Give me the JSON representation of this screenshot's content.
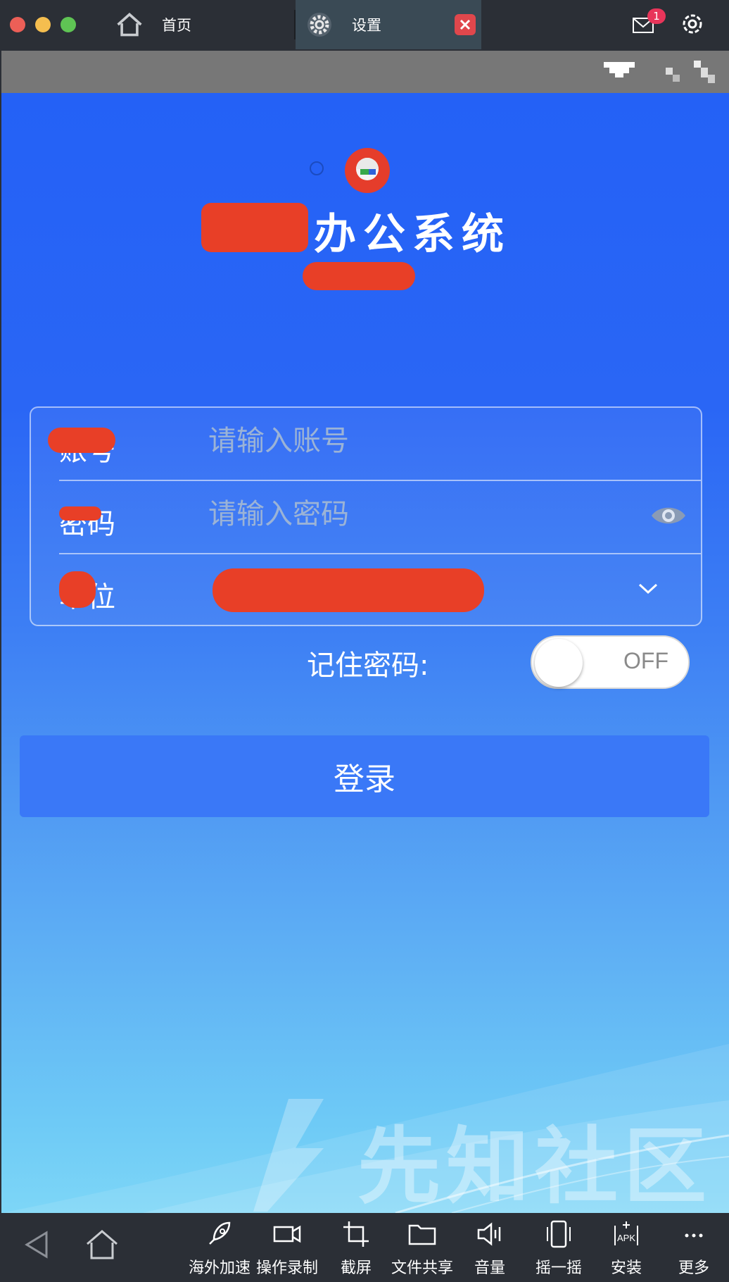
{
  "titlebar": {
    "tabs": [
      {
        "label": "首页",
        "icon": "home-icon"
      },
      {
        "label": "设置",
        "icon": "gear-icon"
      }
    ],
    "mail_badge": "1"
  },
  "screen": {
    "app_title": "办公系统",
    "form": {
      "account_label": "账号",
      "account_placeholder": "请输入账号",
      "password_label": "密码",
      "password_placeholder": "请输入密码",
      "unit_label": "单位"
    },
    "remember_label": "记住密码:",
    "remember_state": "OFF",
    "login_label": "登录"
  },
  "watermark": "先知社区",
  "toolbar": {
    "items": [
      {
        "label": "海外加速",
        "icon": "rocket-icon"
      },
      {
        "label": "操作录制",
        "icon": "video-camera-icon"
      },
      {
        "label": "截屏",
        "icon": "crop-icon"
      },
      {
        "label": "文件共享",
        "icon": "folder-icon"
      },
      {
        "label": "音量",
        "icon": "speaker-icon"
      },
      {
        "label": "摇一摇",
        "icon": "shake-phone-icon"
      },
      {
        "label": "安装",
        "icon": "apk-install-icon"
      },
      {
        "label": "更多",
        "icon": "more-icon"
      }
    ]
  },
  "colors": {
    "titlebar_bg": "#2b2f36",
    "screen_top": "#2461f6",
    "screen_bottom": "#7dd6f7",
    "redaction": "#e83f27",
    "badge": "#e8355a"
  }
}
